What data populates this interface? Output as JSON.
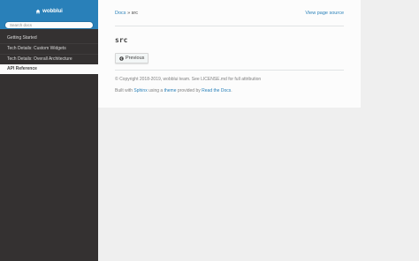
{
  "sidebar": {
    "project_name": "wobblui",
    "search_placeholder": "Search docs",
    "items": [
      {
        "label": "Getting Started"
      },
      {
        "label": "Tech Details: Custom Widgets"
      },
      {
        "label": "Tech Details: Overall Architecture"
      },
      {
        "label": "API Reference",
        "current": true
      }
    ]
  },
  "breadcrumbs": {
    "docs_label": "Docs",
    "separator": "»",
    "current": "src",
    "view_source_label": "View page source"
  },
  "page": {
    "title": "src",
    "previous_label": "Previous"
  },
  "footer": {
    "copyright": "© Copyright 2018-2019, wobblui team. See LICENSE.md for full attribution",
    "built_prefix": "Built with",
    "sphinx_label": "Sphinx",
    "using_a": "using a",
    "theme_label": "theme",
    "provided_by": "provided by",
    "rtd_label": "Read the Docs",
    "period": "."
  },
  "colors": {
    "accent": "#2980b9",
    "sidebar_bg": "#343131",
    "page_bg": "#efefef",
    "content_bg": "#fcfcfc"
  },
  "icons": {
    "home": "home-icon",
    "previous": "circle-arrow-left-icon"
  }
}
